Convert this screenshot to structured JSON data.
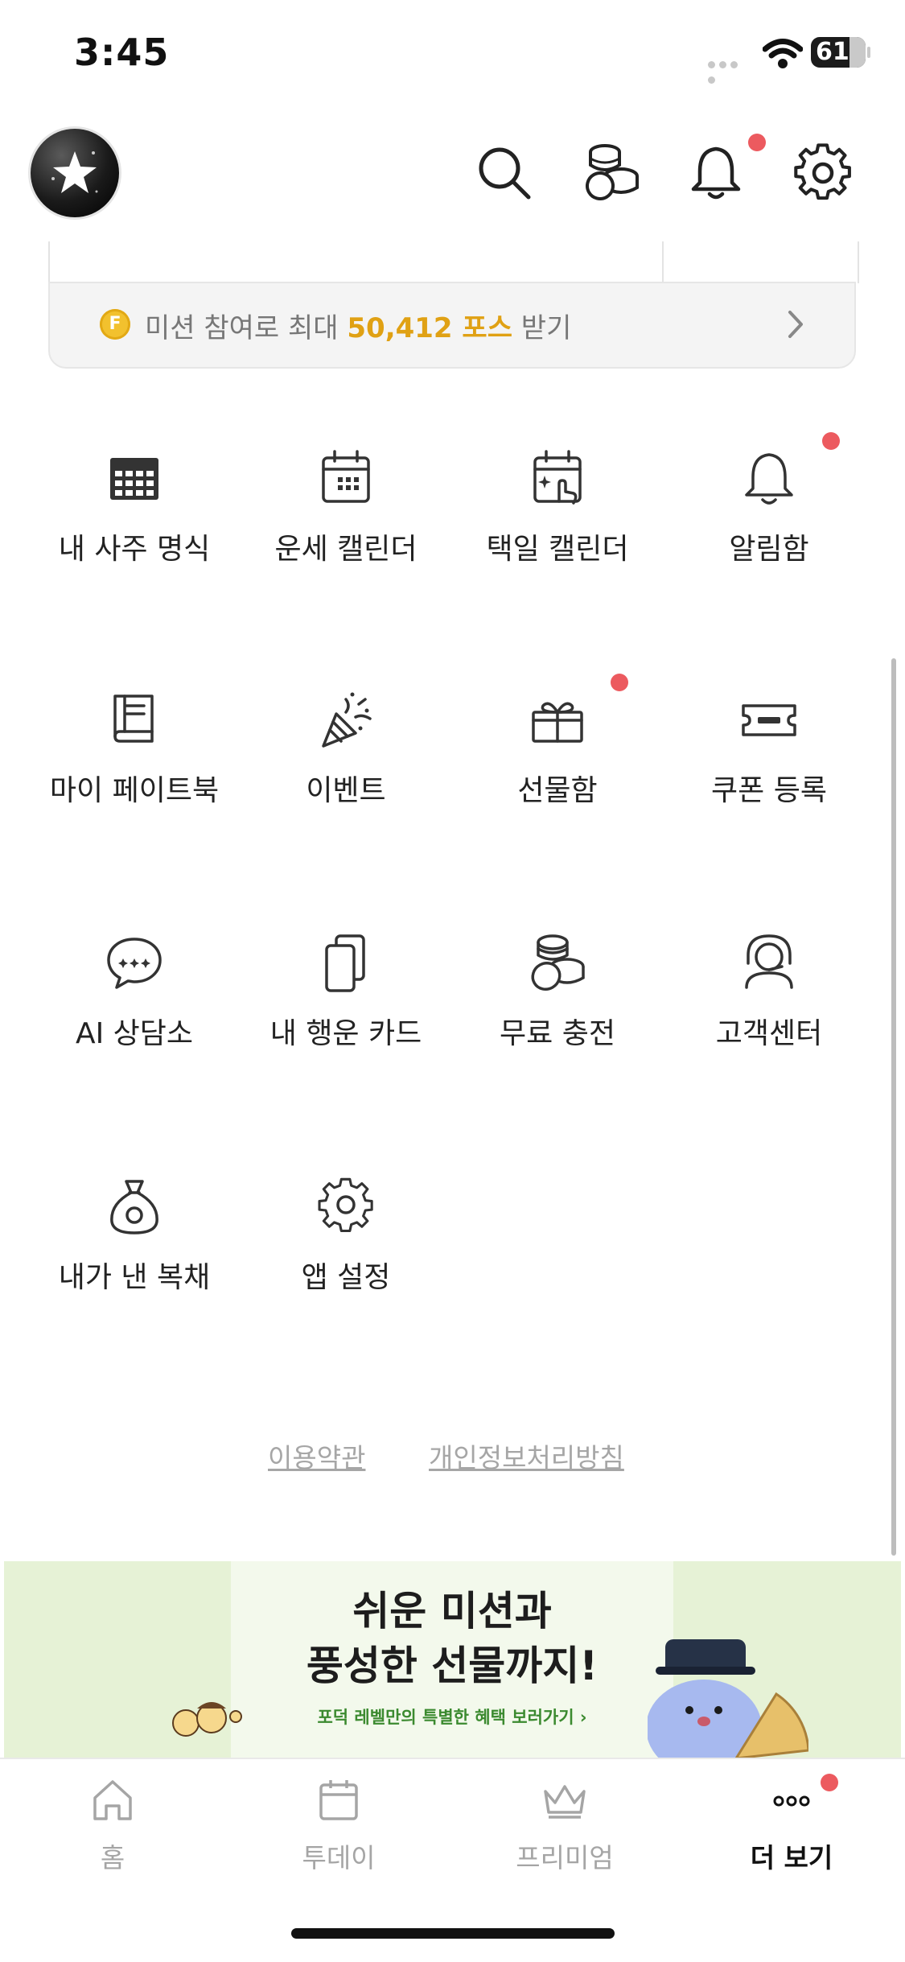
{
  "status_bar": {
    "time": "3:45",
    "battery": "61"
  },
  "header": {
    "icons": [
      "search-icon",
      "coins-icon",
      "bell-icon",
      "gear-icon"
    ],
    "notification_dot_color": "#ec5a5f"
  },
  "mission": {
    "coin_letter": "F",
    "prefix": "미션 참여로 최대 ",
    "amount": "50,412 포스",
    "suffix": " 받기",
    "highlight_color": "#e0a114"
  },
  "menu": [
    {
      "label": "내 사주 명식",
      "icon": "calendar-grid-icon"
    },
    {
      "label": "운세 캘린더",
      "icon": "calendar-icon"
    },
    {
      "label": "택일 캘린더",
      "icon": "calendar-select-icon"
    },
    {
      "label": "알림함",
      "icon": "bell-icon",
      "badge": true
    },
    {
      "label": "마이 페이트북",
      "icon": "book-icon"
    },
    {
      "label": "이벤트",
      "icon": "party-popper-icon"
    },
    {
      "label": "선물함",
      "icon": "gift-icon",
      "badge": true
    },
    {
      "label": "쿠폰 등록",
      "icon": "ticket-icon"
    },
    {
      "label": "AI 상담소",
      "icon": "chat-bubble-icon"
    },
    {
      "label": "내 행운 카드",
      "icon": "cards-icon"
    },
    {
      "label": "무료 충전",
      "icon": "coins-icon"
    },
    {
      "label": "고객센터",
      "icon": "headset-icon"
    },
    {
      "label": "내가 낸 복채",
      "icon": "money-bag-icon"
    },
    {
      "label": "앱 설정",
      "icon": "gear-icon"
    }
  ],
  "footer_links": {
    "terms": "이용약관",
    "privacy": "개인정보처리방침"
  },
  "banner": {
    "title_line1": "쉬운 미션과",
    "title_line2": "풍성한 선물까지!",
    "subtitle": "포덕 레벨만의 특별한 혜택 보러가기  ›"
  },
  "tabs": [
    {
      "label": "홈",
      "icon": "home-icon"
    },
    {
      "label": "투데이",
      "icon": "calendar-icon"
    },
    {
      "label": "프리미엄",
      "icon": "crown-icon"
    },
    {
      "label": "더 보기",
      "icon": "more-icon",
      "active": true,
      "badge": true
    }
  ]
}
